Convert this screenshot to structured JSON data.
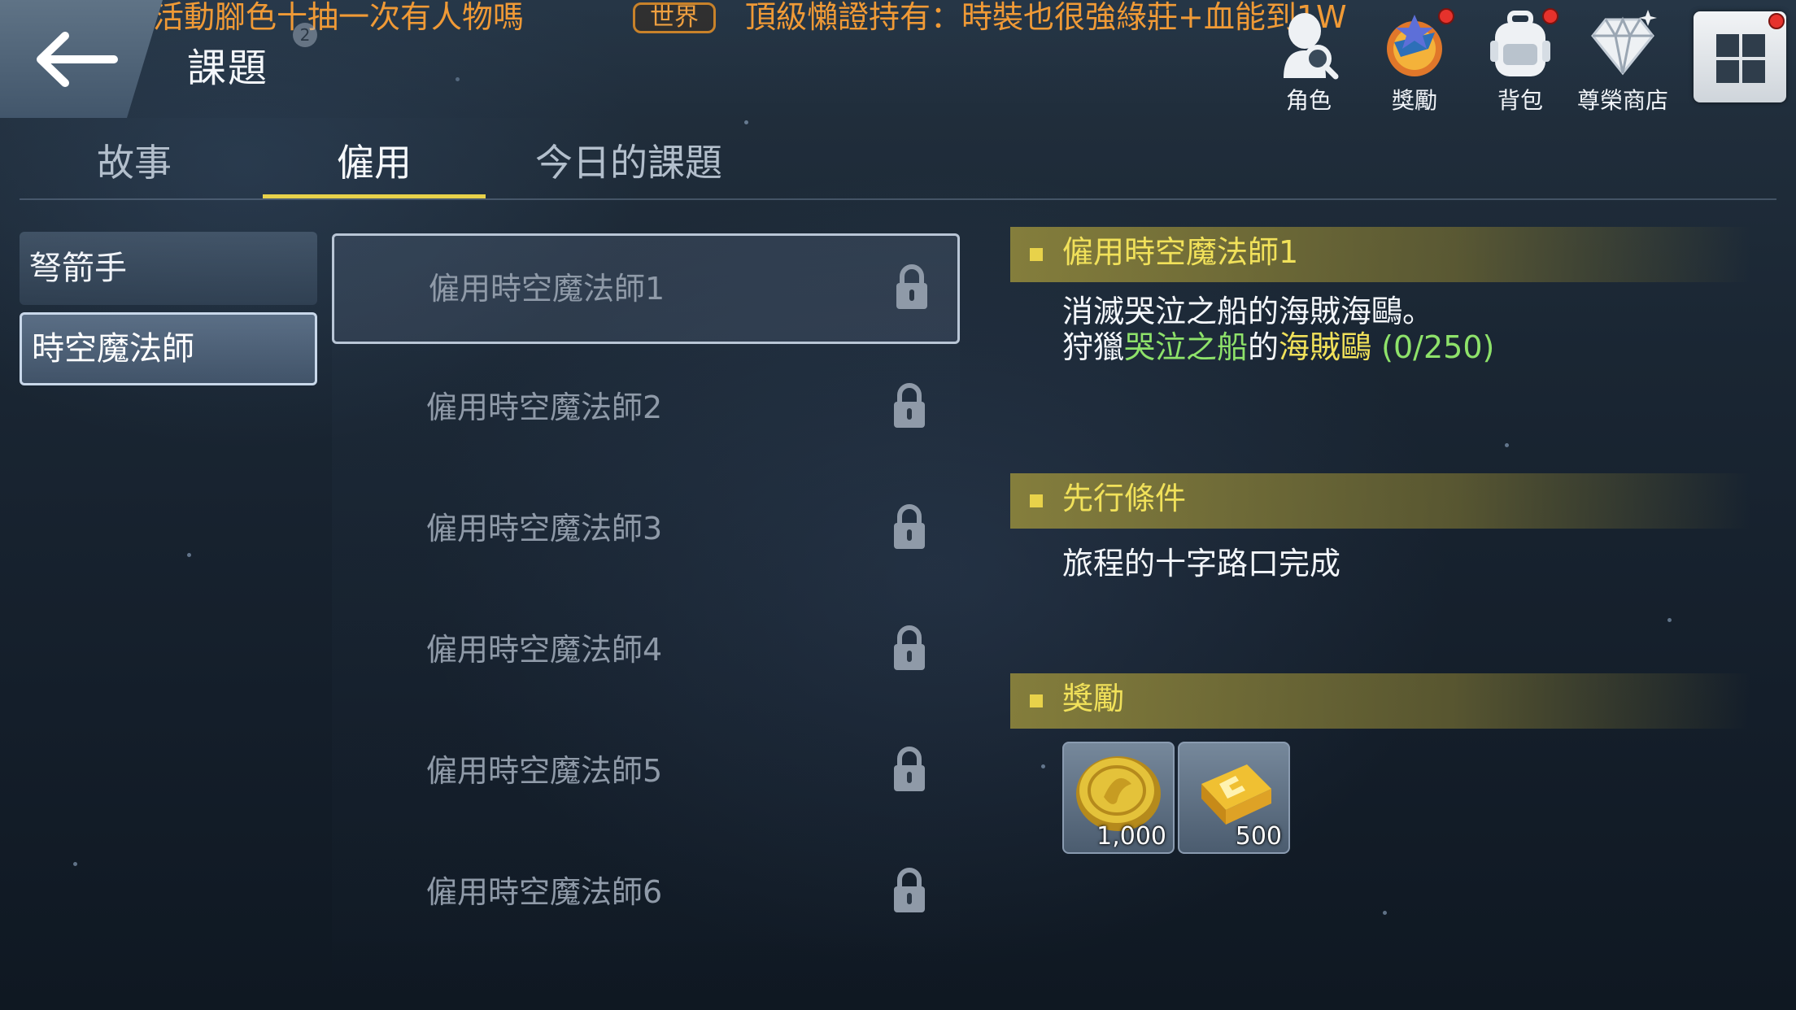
{
  "ticker": {
    "channel_left": "界",
    "message_1": "天雲：活動腳色十抽一次有人物嗎",
    "channel_right": "世界",
    "message_2": "頂級懶證持有：時裝也很強綠莊+血能到1W"
  },
  "header": {
    "title": "課題",
    "title_badge": "2",
    "icons": [
      {
        "label": "角色",
        "icon": "character-search-icon",
        "dot": false
      },
      {
        "label": "獎勵",
        "icon": "reward-icon",
        "dot": true
      },
      {
        "label": "背包",
        "icon": "backpack-icon",
        "dot": true
      },
      {
        "label": "尊榮商店",
        "icon": "diamond-shop-icon",
        "dot": false
      }
    ],
    "menu_dot": true
  },
  "tabs": [
    {
      "label": "故事",
      "active": false
    },
    {
      "label": "僱用",
      "active": true
    },
    {
      "label": "今日的課題",
      "active": false
    }
  ],
  "classes": [
    {
      "label": "弩箭手",
      "selected": false
    },
    {
      "label": "時空魔法師",
      "selected": true
    }
  ],
  "quests": [
    {
      "label": "僱用時空魔法師1",
      "locked": true,
      "selected": true
    },
    {
      "label": "僱用時空魔法師2",
      "locked": true,
      "selected": false
    },
    {
      "label": "僱用時空魔法師3",
      "locked": true,
      "selected": false
    },
    {
      "label": "僱用時空魔法師4",
      "locked": true,
      "selected": false
    },
    {
      "label": "僱用時空魔法師5",
      "locked": true,
      "selected": false
    },
    {
      "label": "僱用時空魔法師6",
      "locked": true,
      "selected": false
    }
  ],
  "detail": {
    "quest_title": "僱用時空魔法師1",
    "description": "消滅哭泣之船的海賊海鷗。",
    "objective": {
      "prefix": "狩獵",
      "location": "哭泣之船",
      "connector": "的",
      "target": "海賊鷗",
      "progress": "(0/250)"
    },
    "prereq_title": "先行條件",
    "prereq_text": "旅程的十字路口完成",
    "reward_title": "獎勵",
    "rewards": [
      {
        "icon": "gold-coin-icon",
        "quantity": "1,000"
      },
      {
        "icon": "xp-ticket-icon",
        "quantity": "500"
      }
    ]
  },
  "colors": {
    "accent_yellow": "#e8d24a",
    "ticker_orange": "#f09a36",
    "highlight_green": "#8ee26a",
    "notify_red": "#e6322c"
  }
}
